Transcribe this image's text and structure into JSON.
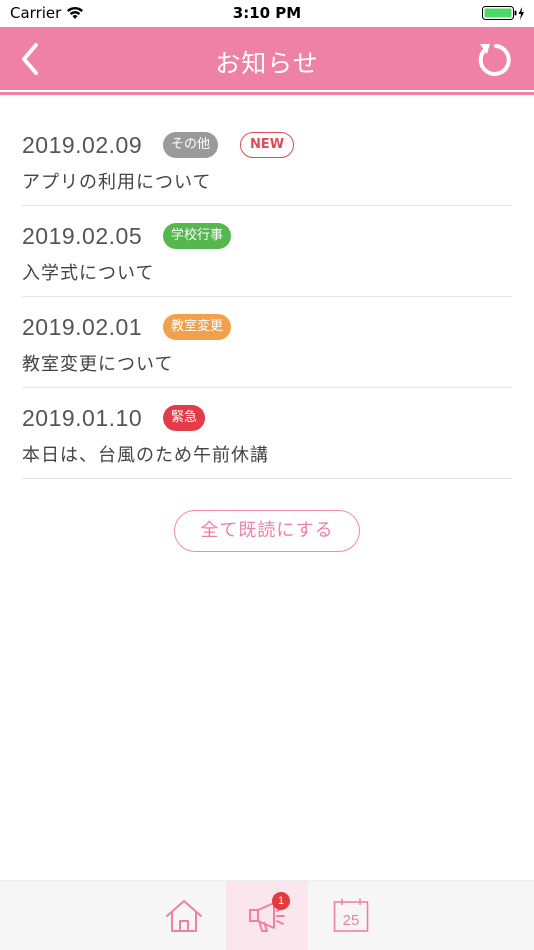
{
  "status_bar": {
    "carrier": "Carrier",
    "time": "3:10 PM"
  },
  "nav": {
    "title": "お知らせ",
    "back_icon": "chevron-left-icon",
    "refresh_icon": "refresh-icon"
  },
  "colors": {
    "primary": "#ef80a6",
    "badge_other": "#9a9a9a",
    "badge_school_event": "#55b84e",
    "badge_class_change": "#f2a04a",
    "badge_urgent": "#e23b4a",
    "new_badge": "#e04a57"
  },
  "notices": [
    {
      "date": "2019.02.09",
      "category": "その他",
      "category_color": "#9a9a9a",
      "is_new": "NEW",
      "title": "アプリの利用について"
    },
    {
      "date": "2019.02.05",
      "category": "学校行事",
      "category_color": "#55b84e",
      "title": "入学式について"
    },
    {
      "date": "2019.02.01",
      "category": "教室変更",
      "category_color": "#f2a04a",
      "title": "教室変更について"
    },
    {
      "date": "2019.01.10",
      "category": "緊急",
      "category_color": "#e23b4a",
      "title": "本日は、台風のため午前休講"
    }
  ],
  "mark_all_read_label": "全て既読にする",
  "tab_bar": {
    "home_icon": "home-icon",
    "news_icon": "megaphone-icon",
    "news_badge_count": "1",
    "calendar_icon": "calendar-icon",
    "calendar_day": "25"
  }
}
